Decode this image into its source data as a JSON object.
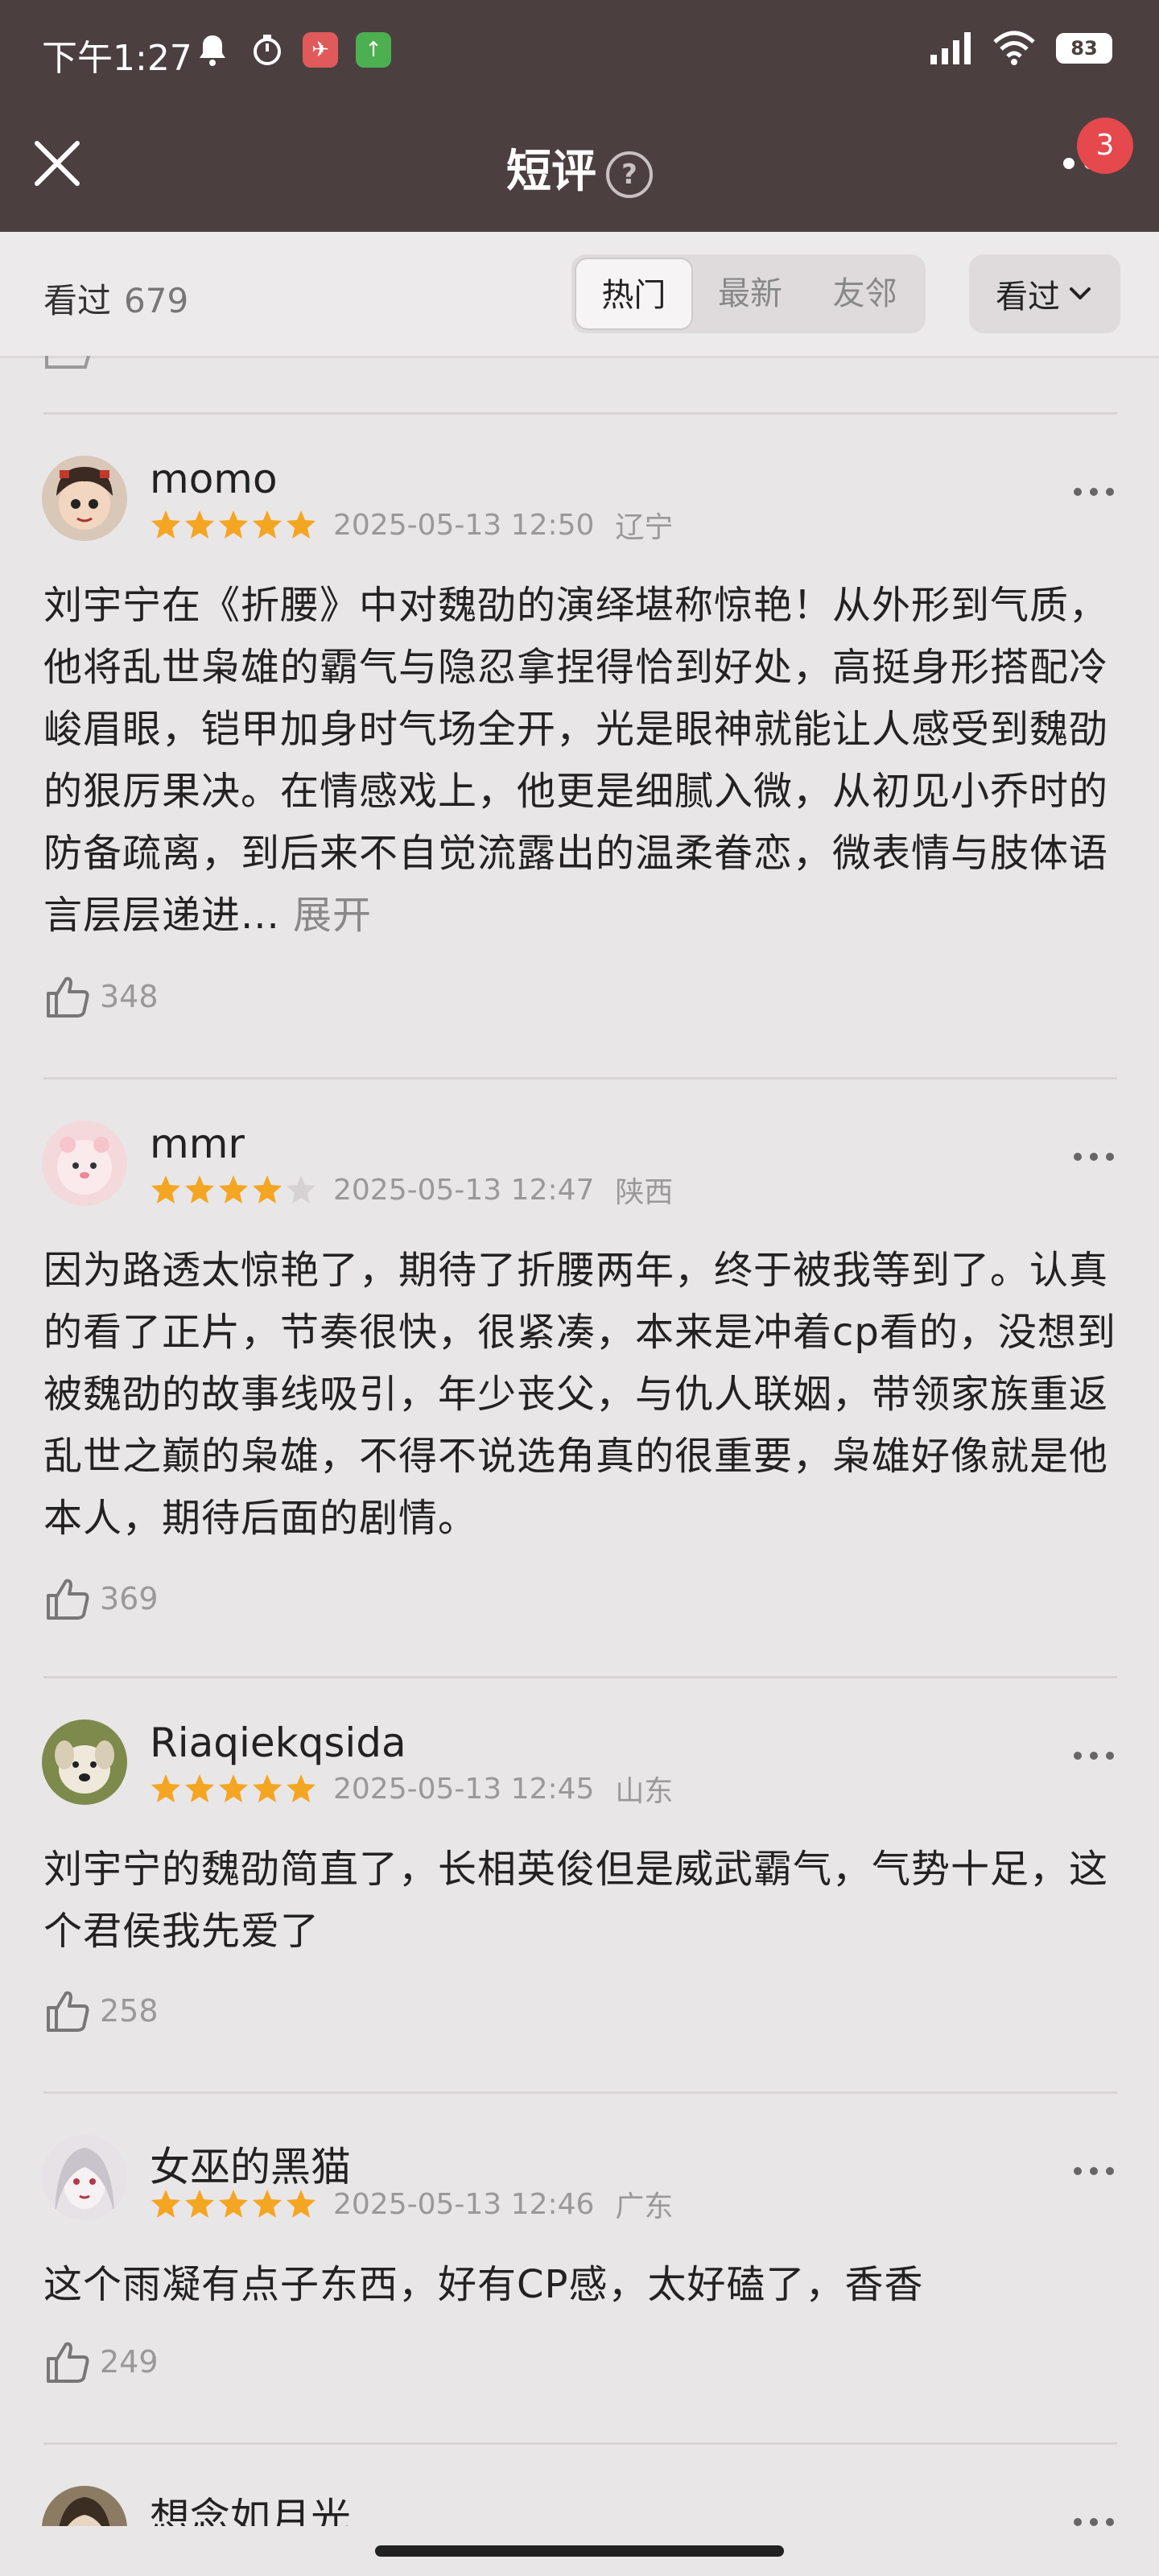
{
  "status_bar": {
    "time": "下午1:27",
    "battery": "83"
  },
  "nav": {
    "title": "短评",
    "help": "?",
    "badge_count": "3"
  },
  "filter": {
    "count_label": "看过",
    "count": "679",
    "tabs": [
      "热门",
      "最新",
      "友邻"
    ],
    "active_tab": "热门",
    "dropdown_label": "看过"
  },
  "reviews": [
    {
      "username": "momo",
      "rating": 5,
      "date": "2025-05-13 12:50",
      "location": "辽宁",
      "text": "刘宇宁在《折腰》中对魏劭的演绎堪称惊艳！从外形到气质，他将乱世枭雄的霸气与隐忍拿捏得恰到好处，高挺身形搭配冷峻眉眼，铠甲加身时气场全开，光是眼神就能让人感受到魏劭的狠厉果决。在情感戏上，他更是细腻入微，从初见小乔时的防备疏离，到后来不自觉流露出的温柔眷恋，微表情与肢体语言层层递进...",
      "expand_label": "展开",
      "likes": "348"
    },
    {
      "username": "mmr",
      "rating": 4,
      "date": "2025-05-13 12:47",
      "location": "陕西",
      "text": "因为路透太惊艳了，期待了折腰两年，终于被我等到了。认真的看了正片，节奏很快，很紧凑，本来是冲着cp看的，没想到被魏劭的故事线吸引，年少丧父，与仇人联姻，带领家族重返乱世之巅的枭雄，不得不说选角真的很重要，枭雄好像就是他本人，期待后面的剧情。",
      "likes": "369"
    },
    {
      "username": "Riaqiekqsida",
      "rating": 5,
      "date": "2025-05-13 12:45",
      "location": "山东",
      "text": "刘宇宁的魏劭简直了，长相英俊但是威武霸气，气势十足，这个君侯我先爱了",
      "likes": "258"
    },
    {
      "username": "女巫的黑猫",
      "rating": 5,
      "date": "2025-05-13 12:46",
      "location": "广东",
      "text": "这个雨凝有点子东西，好有CP感，太好磕了，香香",
      "likes": "249"
    },
    {
      "username": "想念如月光"
    }
  ],
  "colors": {
    "header_bg": "#4b3f40",
    "star": "#f4a623",
    "star_empty": "#d6d2d3",
    "badge": "#e5484d"
  }
}
